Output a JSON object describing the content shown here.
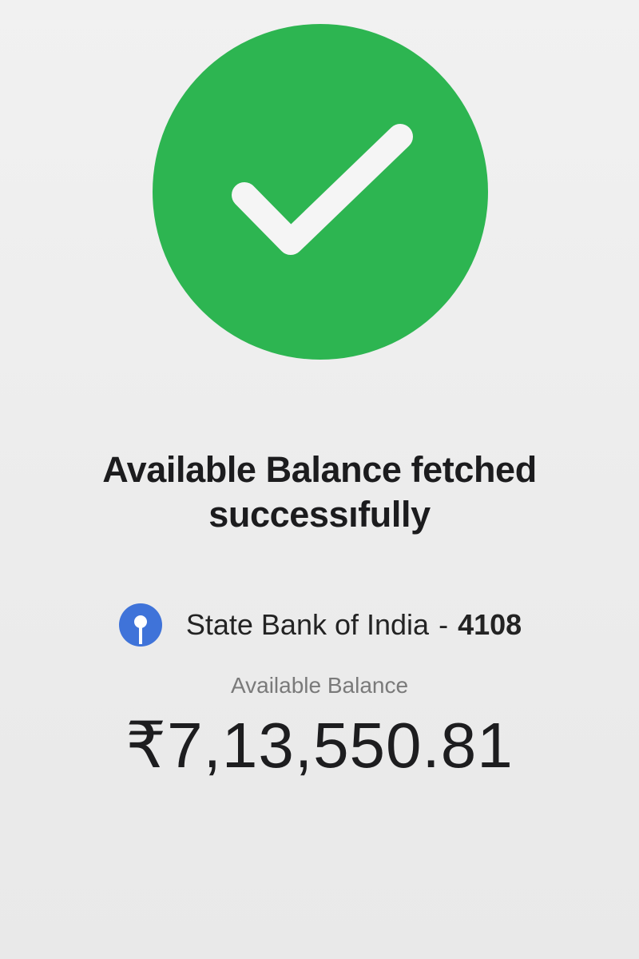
{
  "status": {
    "icon": "check-icon",
    "color": "#2db551"
  },
  "headline": {
    "line1": "Available Balance fetched",
    "line2": "successıfully"
  },
  "bank": {
    "logo_icon": "sbi-logo-icon",
    "logo_color": "#3f73d9",
    "name": "State Bank of India",
    "separator": "-",
    "account_suffix": "4108"
  },
  "balance": {
    "label": "Available Balance",
    "amount": "₹7,13,550.81"
  }
}
